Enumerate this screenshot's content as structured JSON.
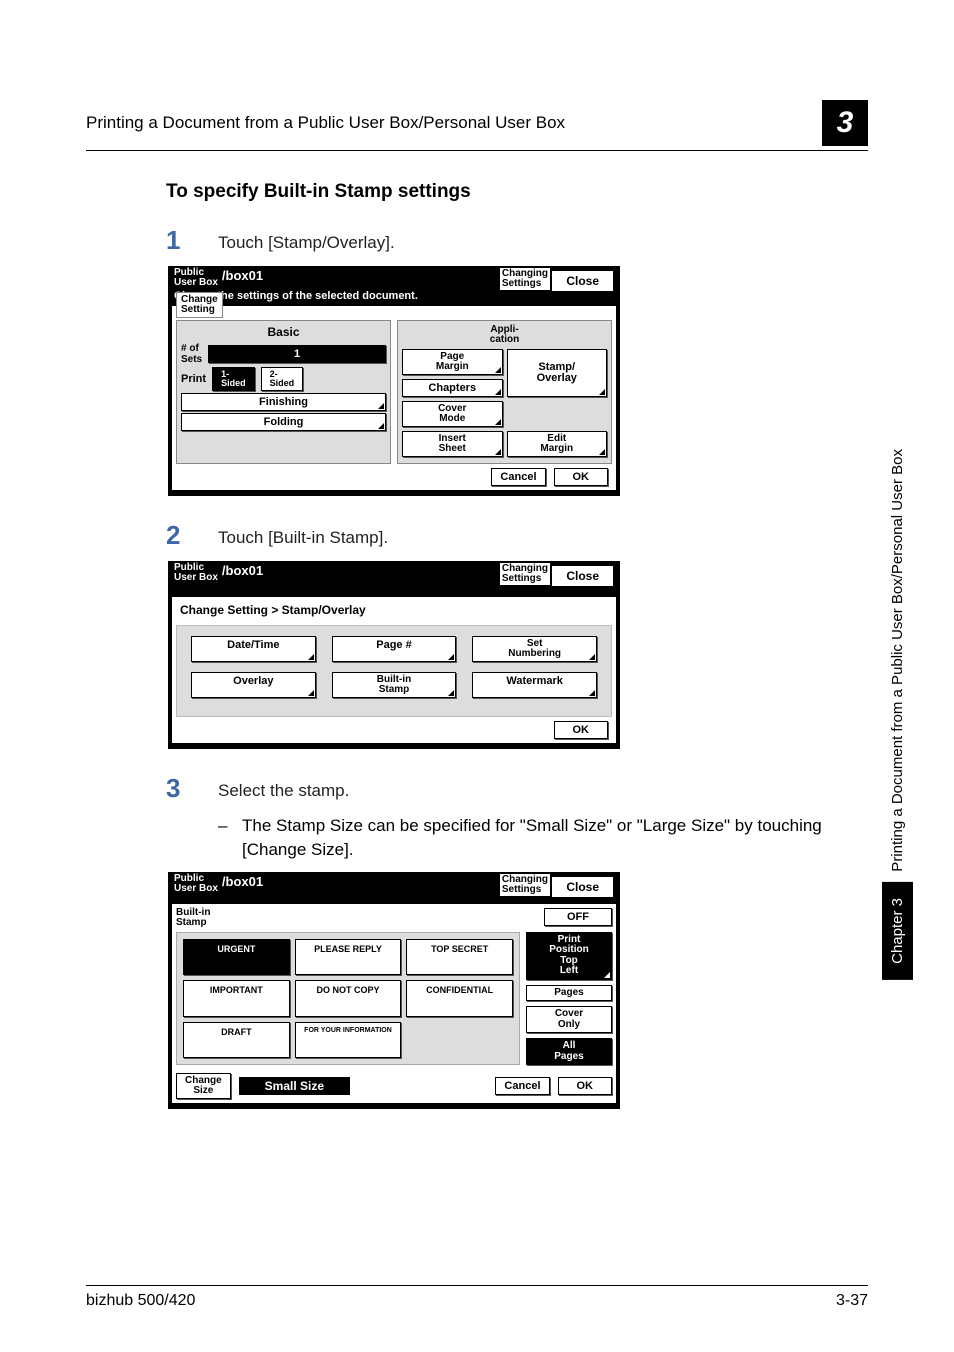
{
  "running_header": {
    "title": "Printing a Document from a Public User Box/Personal User Box",
    "chapter_number": "3"
  },
  "side_tab": {
    "chapter": "Chapter 3",
    "section": "Printing a Document from a Public User Box/Personal User Box"
  },
  "section_title": "To specify Built-in Stamp settings",
  "steps": {
    "s1": {
      "num": "1",
      "text": "Touch [Stamp/Overlay]."
    },
    "s2": {
      "num": "2",
      "text": "Touch [Built-in Stamp]."
    },
    "s3": {
      "num": "3",
      "text": "Select the stamp.",
      "sub": "The Stamp Size can be specified for \"Small Size\" or \"Large Size\" by touching [Change Size]."
    }
  },
  "panel_common": {
    "box_label": "Public\nUser Box",
    "box_path": "/box01",
    "changing_settings": "Changing\nSettings",
    "close": "Close"
  },
  "panel1": {
    "sub": "Change the settings of the selected document.",
    "tab": "Change\nSetting",
    "basic_header": "Basic",
    "appli_header": "Appli-\ncation",
    "sets_label": "# of\nSets",
    "sets_value": "1",
    "print_label": "Print",
    "sided1": "1-\nSided",
    "sided2": "2-\nSided",
    "finishing": "Finishing",
    "folding": "Folding",
    "page_margin": "Page\nMargin",
    "chapters": "Chapters",
    "cover_mode": "Cover\nMode",
    "insert_sheet": "Insert\nSheet",
    "stamp_overlay": "Stamp/\nOverlay",
    "edit_margin": "Edit\nMargin",
    "cancel": "Cancel",
    "ok": "OK"
  },
  "panel2": {
    "crumb": "Change Setting > Stamp/Overlay",
    "date_time": "Date/Time",
    "page_no": "Page #",
    "set_numbering": "Set\nNumbering",
    "overlay": "Overlay",
    "built_in_stamp": "Built-in\nStamp",
    "watermark": "Watermark",
    "ok": "OK"
  },
  "panel3": {
    "label": "Built-in\nStamp",
    "off": "OFF",
    "urgent": "URGENT",
    "please_reply": "PLEASE REPLY",
    "top_secret": "TOP SECRET",
    "important": "IMPORTANT",
    "do_not_copy": "DO NOT COPY",
    "confidential": "CONFIDENTIAL",
    "draft": "DRAFT",
    "fyi": "FOR YOUR INFORMATION",
    "print_position": "Print\nPosition\nTop\nLeft",
    "pages": "Pages",
    "cover_only": "Cover\nOnly",
    "all_pages": "All\nPages",
    "change_size": "Change\nSize",
    "size_val": "Small Size",
    "cancel": "Cancel",
    "ok": "OK"
  },
  "footer": {
    "left": "bizhub 500/420",
    "right": "3-37"
  }
}
